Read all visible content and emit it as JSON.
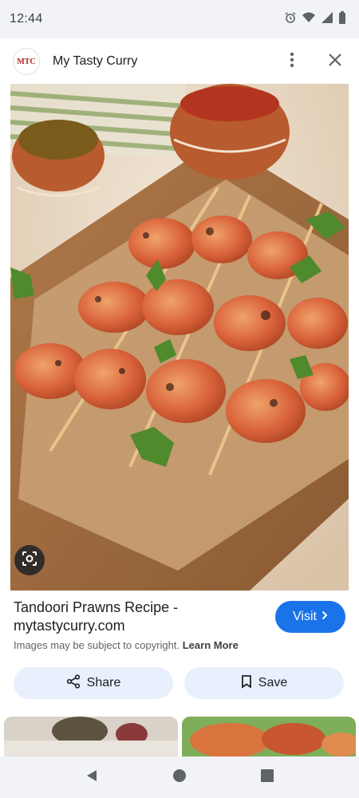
{
  "status_bar": {
    "time": "12:44"
  },
  "header": {
    "logo_text": "MTC",
    "site_name": "My Tasty Curry"
  },
  "result": {
    "title": "Tandoori Prawns Recipe - mytastycurry.com",
    "visit_label": "Visit",
    "copyright_text": "Images may be subject to copyright.",
    "learn_more_label": "Learn More",
    "share_label": "Share",
    "save_label": "Save"
  },
  "colors": {
    "accent": "#1a73e8",
    "pill_bg": "#e8f0fe",
    "chrome_bg": "#f1f3f6"
  },
  "icons": [
    "alarm-icon",
    "wifi-icon",
    "signal-icon",
    "battery-icon",
    "more-vert-icon",
    "close-icon",
    "lens-icon",
    "share-icon",
    "bookmark-icon",
    "back-icon",
    "home-icon",
    "recents-icon"
  ]
}
